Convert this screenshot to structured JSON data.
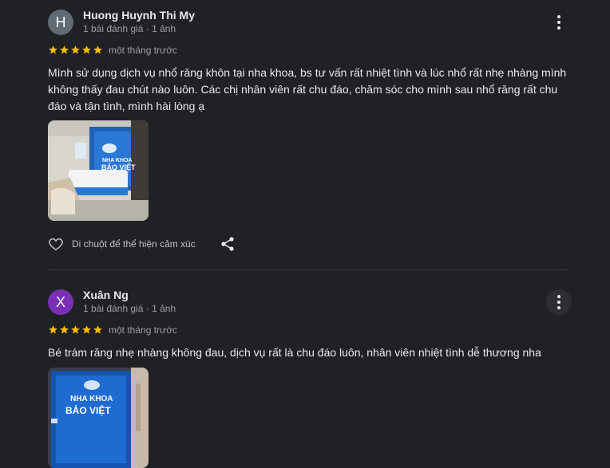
{
  "reviews": [
    {
      "avatar_letter": "H",
      "avatar_color": "#5f6b75",
      "name": "Huong Huynh Thi My",
      "meta": "1 bài đánh giá · 1 ảnh",
      "rating": 5,
      "time": "một tháng trước",
      "text": "Mình sử dụng dịch vụ nhổ răng khôn tại nha khoa, bs tư vấn rất nhiệt tình và lúc nhổ rất nhẹ nhàng mình không thấy đau chút nào luôn. Các chị nhân viên rất chu đáo, chăm sóc cho mình sau nhổ răng rất chu đáo và tận tình, mình hài lòng ạ",
      "photo_icon": "clinic-reception-photo",
      "photo_logo": [
        "NHA KHOA",
        "BẢO VIỆT"
      ],
      "react_label": "Di chuột để thể hiện cảm xúc"
    },
    {
      "avatar_letter": "X",
      "avatar_color": "#7b2fb5",
      "name": "Xuân Ng",
      "meta": "1 bài đánh giá · 1 ảnh",
      "rating": 5,
      "time": "một tháng trước",
      "text": "Bé trám răng nhẹ nhàng không đau, dịch vụ rất là chu đáo luôn, nhân viên nhiệt tình dễ thương nha",
      "photo_icon": "clinic-sign-photo",
      "photo_logo": [
        "NHA KHOA",
        "BẢO VIỆT"
      ]
    }
  ],
  "colors": {
    "star": "#fbbc04",
    "background": "#202124",
    "divider": "#3c4043"
  },
  "icons": {
    "more": "more-vert-icon",
    "like": "heart-outline-icon",
    "share": "share-icon",
    "star": "star-icon"
  }
}
